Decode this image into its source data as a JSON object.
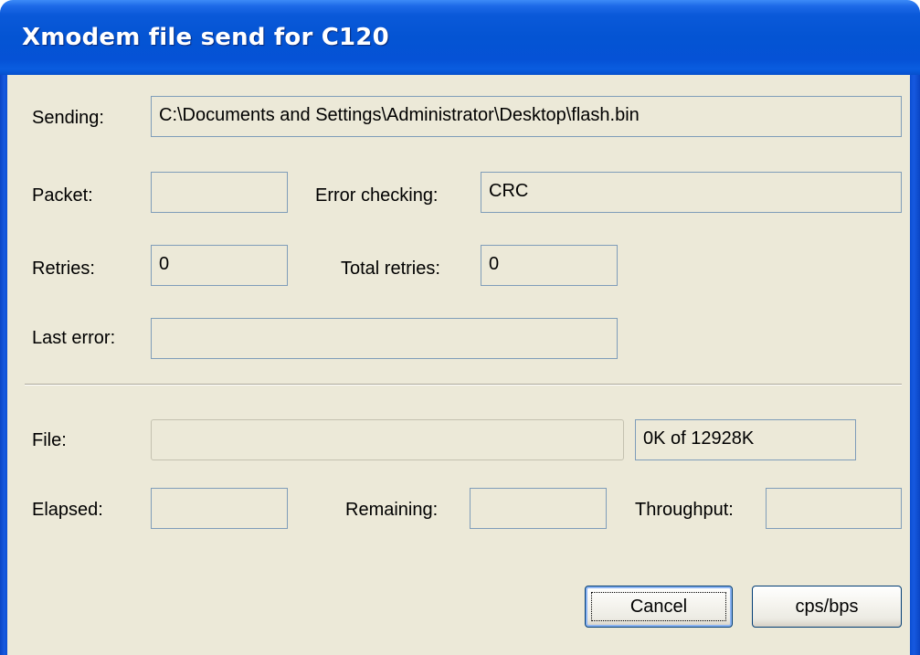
{
  "window": {
    "title": "Xmodem file send for C120"
  },
  "sending": {
    "label": "Sending:",
    "value": "C:\\Documents and Settings\\Administrator\\Desktop\\flash.bin"
  },
  "packet": {
    "label": "Packet:",
    "value": ""
  },
  "error_checking": {
    "label": "Error checking:",
    "value": "CRC"
  },
  "retries": {
    "label": "Retries:",
    "value": "0"
  },
  "total_retries": {
    "label": "Total retries:",
    "value": "0"
  },
  "last_error": {
    "label": "Last error:",
    "value": ""
  },
  "file": {
    "label": "File:",
    "progress_fraction": 0,
    "size_status": "0K of 12928K"
  },
  "elapsed": {
    "label": "Elapsed:",
    "value": ""
  },
  "remaining": {
    "label": "Remaining:",
    "value": ""
  },
  "throughput": {
    "label": "Throughput:",
    "value": ""
  },
  "buttons": {
    "cancel": "Cancel",
    "cps_bps": "cps/bps"
  },
  "colors": {
    "titlebar": "#0454d3",
    "dialog_background": "#ece9d8",
    "field_border": "#7f9db9"
  }
}
